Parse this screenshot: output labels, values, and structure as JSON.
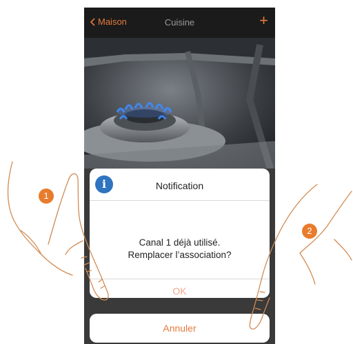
{
  "navbar": {
    "back_label": "Maison",
    "title": "Cuisine",
    "add_label": "+"
  },
  "dialog": {
    "info_glyph": "i",
    "title": "Notification",
    "message_line1": "Canal 1 déjà utilisé.",
    "message_line2": "Remplacer l’association?",
    "ok_label": "OK",
    "cancel_label": "Annuler"
  },
  "callouts": [
    "1",
    "2"
  ],
  "colors": {
    "accent": "#e57a3c",
    "info": "#2f74c0",
    "badge": "#e87c2c"
  },
  "icons": [
    "chevron-left-icon",
    "plus-icon",
    "info-icon"
  ]
}
